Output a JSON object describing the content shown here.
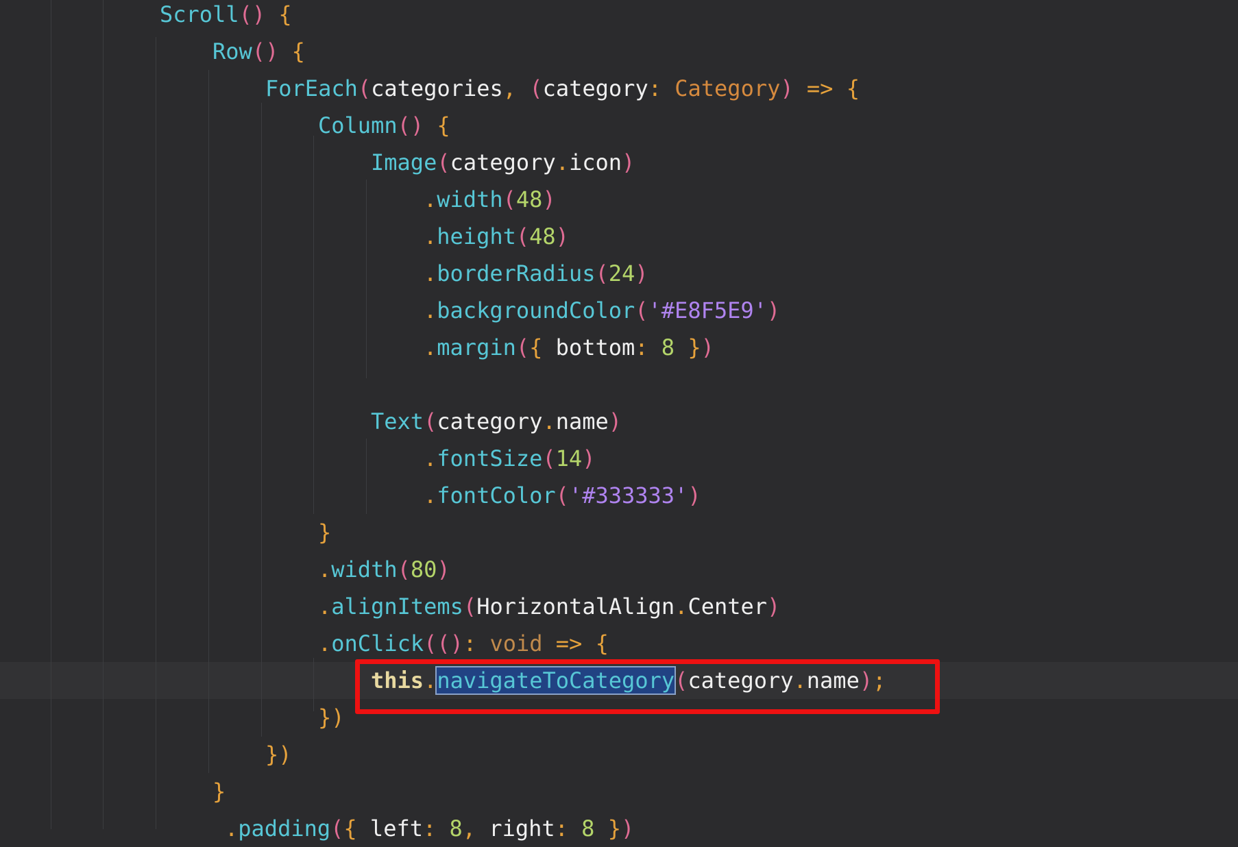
{
  "editor": {
    "lines": [
      [
        [
          "Scroll",
          "c-fn"
        ],
        [
          "(",
          "c-par"
        ],
        [
          ")",
          "c-par"
        ],
        [
          " ",
          ""
        ],
        [
          "{",
          "c-br"
        ]
      ],
      [
        [
          "Row",
          "c-fn"
        ],
        [
          "(",
          "c-par"
        ],
        [
          ")",
          "c-par"
        ],
        [
          " ",
          ""
        ],
        [
          "{",
          "c-br"
        ]
      ],
      [
        [
          "ForEach",
          "c-fn"
        ],
        [
          "(",
          "c-par"
        ],
        [
          "categories",
          "c-id"
        ],
        [
          ",",
          "c-pun"
        ],
        [
          " ",
          ""
        ],
        [
          "(",
          "c-par"
        ],
        [
          "category",
          "c-id"
        ],
        [
          ":",
          "c-pun"
        ],
        [
          " ",
          ""
        ],
        [
          "Category",
          "c-type"
        ],
        [
          ")",
          "c-par"
        ],
        [
          " ",
          ""
        ],
        [
          "=>",
          "c-pun"
        ],
        [
          " ",
          ""
        ],
        [
          "{",
          "c-br"
        ]
      ],
      [
        [
          "Column",
          "c-fn"
        ],
        [
          "(",
          "c-par"
        ],
        [
          ")",
          "c-par"
        ],
        [
          " ",
          ""
        ],
        [
          "{",
          "c-br"
        ]
      ],
      [
        [
          "Image",
          "c-fn"
        ],
        [
          "(",
          "c-par"
        ],
        [
          "category",
          "c-id"
        ],
        [
          ".",
          "c-dot"
        ],
        [
          "icon",
          "c-id"
        ],
        [
          ")",
          "c-par"
        ]
      ],
      [
        [
          ".",
          "c-dot"
        ],
        [
          "width",
          "c-fn"
        ],
        [
          "(",
          "c-par"
        ],
        [
          "48",
          "c-num"
        ],
        [
          ")",
          "c-par"
        ]
      ],
      [
        [
          ".",
          "c-dot"
        ],
        [
          "height",
          "c-fn"
        ],
        [
          "(",
          "c-par"
        ],
        [
          "48",
          "c-num"
        ],
        [
          ")",
          "c-par"
        ]
      ],
      [
        [
          ".",
          "c-dot"
        ],
        [
          "borderRadius",
          "c-fn"
        ],
        [
          "(",
          "c-par"
        ],
        [
          "24",
          "c-num"
        ],
        [
          ")",
          "c-par"
        ]
      ],
      [
        [
          ".",
          "c-dot"
        ],
        [
          "backgroundColor",
          "c-fn"
        ],
        [
          "(",
          "c-par"
        ],
        [
          "'#E8F5E9'",
          "c-str"
        ],
        [
          ")",
          "c-par"
        ]
      ],
      [
        [
          ".",
          "c-dot"
        ],
        [
          "margin",
          "c-fn"
        ],
        [
          "(",
          "c-par"
        ],
        [
          "{",
          "c-br"
        ],
        [
          " ",
          ""
        ],
        [
          "bottom",
          "c-id"
        ],
        [
          ":",
          "c-pun"
        ],
        [
          " ",
          ""
        ],
        [
          "8",
          "c-num"
        ],
        [
          " ",
          ""
        ],
        [
          "}",
          "c-br"
        ],
        [
          ")",
          "c-par"
        ]
      ],
      [],
      [
        [
          "Text",
          "c-fn"
        ],
        [
          "(",
          "c-par"
        ],
        [
          "category",
          "c-id"
        ],
        [
          ".",
          "c-dot"
        ],
        [
          "name",
          "c-id"
        ],
        [
          ")",
          "c-par"
        ]
      ],
      [
        [
          ".",
          "c-dot"
        ],
        [
          "fontSize",
          "c-fn"
        ],
        [
          "(",
          "c-par"
        ],
        [
          "14",
          "c-num"
        ],
        [
          ")",
          "c-par"
        ]
      ],
      [
        [
          ".",
          "c-dot"
        ],
        [
          "fontColor",
          "c-fn"
        ],
        [
          "(",
          "c-par"
        ],
        [
          "'#333333'",
          "c-str"
        ],
        [
          ")",
          "c-par"
        ]
      ],
      [
        [
          "}",
          "c-br"
        ]
      ],
      [
        [
          ".",
          "c-dot"
        ],
        [
          "width",
          "c-fn"
        ],
        [
          "(",
          "c-par"
        ],
        [
          "80",
          "c-num"
        ],
        [
          ")",
          "c-par"
        ]
      ],
      [
        [
          ".",
          "c-dot"
        ],
        [
          "alignItems",
          "c-fn"
        ],
        [
          "(",
          "c-par"
        ],
        [
          "HorizontalAlign",
          "c-id"
        ],
        [
          ".",
          "c-dot"
        ],
        [
          "Center",
          "c-id"
        ],
        [
          ")",
          "c-par"
        ]
      ],
      [
        [
          ".",
          "c-dot"
        ],
        [
          "onClick",
          "c-fn"
        ],
        [
          "(",
          "c-par"
        ],
        [
          "(",
          "c-par"
        ],
        [
          ")",
          "c-par"
        ],
        [
          ":",
          "c-pun"
        ],
        [
          " ",
          ""
        ],
        [
          "void",
          "c-void"
        ],
        [
          " ",
          ""
        ],
        [
          "=>",
          "c-pun"
        ],
        [
          " ",
          ""
        ],
        [
          "{",
          "c-br"
        ]
      ],
      [
        [
          "this",
          "c-kw"
        ],
        [
          ".",
          "c-dot"
        ],
        [
          "navigateToCategory",
          "c-fn selected"
        ],
        [
          "(",
          "c-par"
        ],
        [
          "category",
          "c-id"
        ],
        [
          ".",
          "c-dot"
        ],
        [
          "name",
          "c-id"
        ],
        [
          ")",
          "c-par"
        ],
        [
          ";",
          "c-pun"
        ]
      ],
      [
        [
          "})",
          "c-br"
        ]
      ],
      [
        [
          "})",
          "c-br"
        ]
      ],
      [
        [
          "}",
          "c-br"
        ]
      ],
      [
        [
          ".",
          "c-dot"
        ],
        [
          "padding",
          "c-fn"
        ],
        [
          "(",
          "c-par"
        ],
        [
          "{",
          "c-br"
        ],
        [
          " ",
          ""
        ],
        [
          "left",
          "c-id"
        ],
        [
          ":",
          "c-pun"
        ],
        [
          " ",
          ""
        ],
        [
          "8",
          "c-num"
        ],
        [
          ",",
          "c-pun"
        ],
        [
          " ",
          ""
        ],
        [
          "right",
          "c-id"
        ],
        [
          ":",
          "c-pun"
        ],
        [
          " ",
          ""
        ],
        [
          "8",
          "c-num"
        ],
        [
          " ",
          ""
        ],
        [
          "}",
          "c-br"
        ],
        [
          ")",
          "c-par"
        ]
      ]
    ]
  }
}
